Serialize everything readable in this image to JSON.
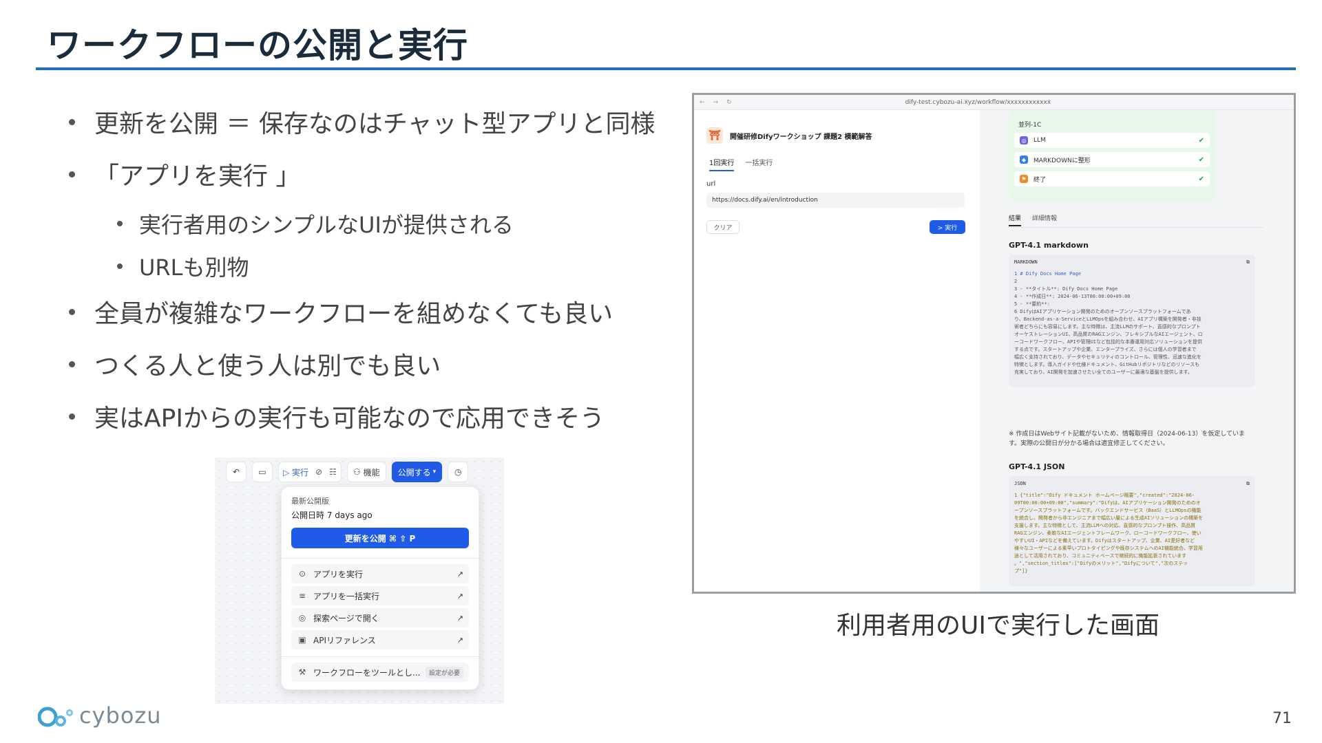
{
  "slide": {
    "title": "ワークフローの公開と実行",
    "page_number": "71",
    "logo_text": "cybozu",
    "caption": "利用者用のUIで実行した画面"
  },
  "bullets": [
    {
      "level": 1,
      "text": "更新を公開 ＝ 保存なのはチャット型アプリと同様"
    },
    {
      "level": 1,
      "text": "「アプリを実行 」"
    },
    {
      "level": 2,
      "text": "実行者用のシンプルなUIが提供される"
    },
    {
      "level": 2,
      "text": "URLも別物"
    },
    {
      "level": 1,
      "text": "全員が複雑なワークフローを組めなくても良い"
    },
    {
      "level": 1,
      "text": "つくる人と使う人は別でも良い"
    },
    {
      "level": 1,
      "text": "実はAPIからの実行も可能なので応用できそう"
    }
  ],
  "publish_menu": {
    "toolbar": {
      "run": "▷ 実行",
      "features": "機能",
      "publish": "公開する"
    },
    "latest_label": "最新公開版",
    "published_time": "公開日時 7 days ago",
    "update_button": "更新を公開 ⌘ ⇧ P",
    "items": [
      {
        "icon": "⊙",
        "label": "アプリを実行",
        "arrow": "↗"
      },
      {
        "icon": "≡",
        "label": "アプリを一括実行",
        "arrow": "↗"
      },
      {
        "icon": "◎",
        "label": "探索ページで開く",
        "arrow": "↗"
      },
      {
        "icon": "▣",
        "label": "APIリファレンス",
        "arrow": "↗"
      }
    ],
    "tool_item": {
      "label": "ワークフローをツールとし...",
      "badge": "設定が必要"
    }
  },
  "browser": {
    "url": "dify-test.cybozu-ai.xyz/workflow/xxxxxxxxxxxx",
    "app_title": "開催研修Difyワークショップ 課題2 模範解答",
    "tabs": [
      "1回実行",
      "一括実行"
    ],
    "input_label": "url",
    "input_value": "https://docs.dify.ai/en/introduction",
    "clear_button": "クリア",
    "run_button": "> 実行",
    "flow": {
      "title": "並列-1C",
      "nodes": [
        {
          "label": "LLM",
          "color": "#6a63e8",
          "icon": "◎"
        },
        {
          "label": "MARKDOWNに整形",
          "color": "#2f80ed",
          "icon": "◆"
        },
        {
          "label": "終了",
          "color": "#f08a24",
          "icon": "⚑"
        }
      ]
    },
    "result_tabs": [
      "結果",
      "詳細情報"
    ],
    "section_md": "GPT-4.1 markdown",
    "md_header": "MARKDOWN",
    "md_lines": [
      "1  # Dify Docs Home Page",
      "2",
      "3  - **タイトル**: Dify Docs Home Page",
      "4  - **作成日**: 2024-06-13T00:00:00+09:00",
      "5  - **要約**:",
      "6    DifyはAIアプリケーション開発のためのオープンソースプラットフォームであ",
      "り、Backend-as-a-ServiceとLLMOpsを組み合わせ、AIアプリ構築を開発者・非技",
      "術者どちらにも容易にします。主な特徴は、主流LLMのサポート、直感的なプロンプト",
      "オーケストレーションUI、高品質のRAGエンジン、フレキシブルなAIエージェント、ロ",
      "ーコードワークフロー、APIや管理UIなど包括的な本番運用対応ソリューションを提供",
      "する点です。スタートアップや企業、エンタープライズ、さらには個人の学習者まで",
      "幅広く支持されており、データやセキュリティのコントロール、管理性、迅速な進化を",
      "特徴とします。導入ガイドや仕様ドキュメント、GitHubリポジトリなどのリソースも",
      "充実しており、AI開発を加速させたい全てのユーザーに最適な基盤を提供します。"
    ],
    "note": "※ 作成日はWebサイト記載がないため、情報取得日（2024-06-13）を仮定しています。実際の公開日が分かる場合は適宜修正してください。",
    "section_json": "GPT-4.1 JSON",
    "json_header": "JSON",
    "json_lines": [
      "1  {\"title\":\"Dify ドキュメント ホームページ概要\",\"created\":\"2024-06-",
      "09T00:00:00+09:00\",\"summary\":\"Difyは、AIアプリケーション開発のためのオ",
      "ープンソースプラットフォームです。バックエンドサービス（BaaS）とLLMOpsの機能",
      "を統合し、開発者から非エンジニアまで幅広い層による生成AIソリューションの構築を",
      "支援します。主な特徴として、主流LLMへの対応、直感的なプロンプト操作、高品質",
      "RAGエンジン、柔軟なAIエージェントフレームワーク、ローコードワークフロー、使い",
      "やすいUI・APIなどを備えています。Difyはスタートアップ、企業、AI愛好者など",
      "様々なユーザーによる素早いプロトタイピングや既存システムへのAI機能統合、学習用",
      "途として活用されており、コミュニティベースで継続的に機能拡張されています",
      "。\",\"section_titles\":[\"Difyのメリット\",\"Difyについて\",\"次のステッ",
      "プ\"]}"
    ]
  },
  "colors": {
    "accent": "#1f6fb2",
    "primary_button": "#1f5be6",
    "success": "#1ea35c"
  }
}
